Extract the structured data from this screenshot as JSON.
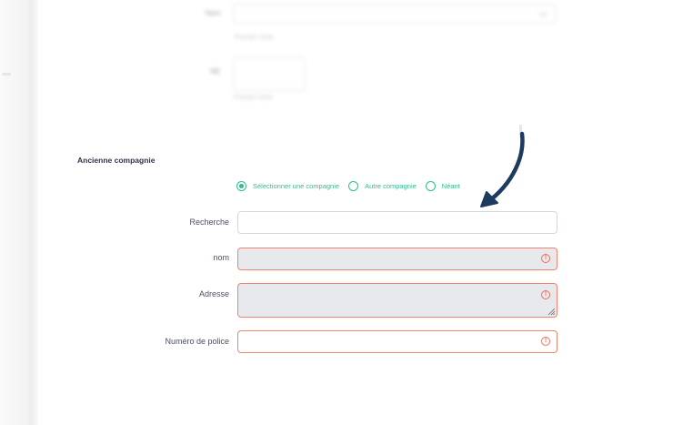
{
  "background_form": {
    "rows": [
      {
        "label": "Nom",
        "hint": "Premier choix"
      },
      {
        "label": "NE",
        "hint": "Premier choix"
      }
    ]
  },
  "section": {
    "title": "Ancienne compagnie"
  },
  "radio_options": [
    {
      "label": "Sélectionner une compagnie",
      "checked": true
    },
    {
      "label": "Autre compagnie",
      "checked": false
    },
    {
      "label": "Néant",
      "checked": false
    }
  ],
  "fields": {
    "recherche": {
      "label": "Recherche",
      "value": ""
    },
    "nom": {
      "label": "nom",
      "value": "",
      "error_icon": "alert-circle-icon"
    },
    "adresse": {
      "label": "Adresse",
      "value": "",
      "error_icon": "alert-circle-icon"
    },
    "police": {
      "label": "Numéro de police",
      "value": "",
      "error_icon": "alert-circle-icon"
    }
  },
  "colors": {
    "accent_green": "#2bbf8f",
    "error": "#f0836e",
    "arrow": "#1d3a5f"
  }
}
